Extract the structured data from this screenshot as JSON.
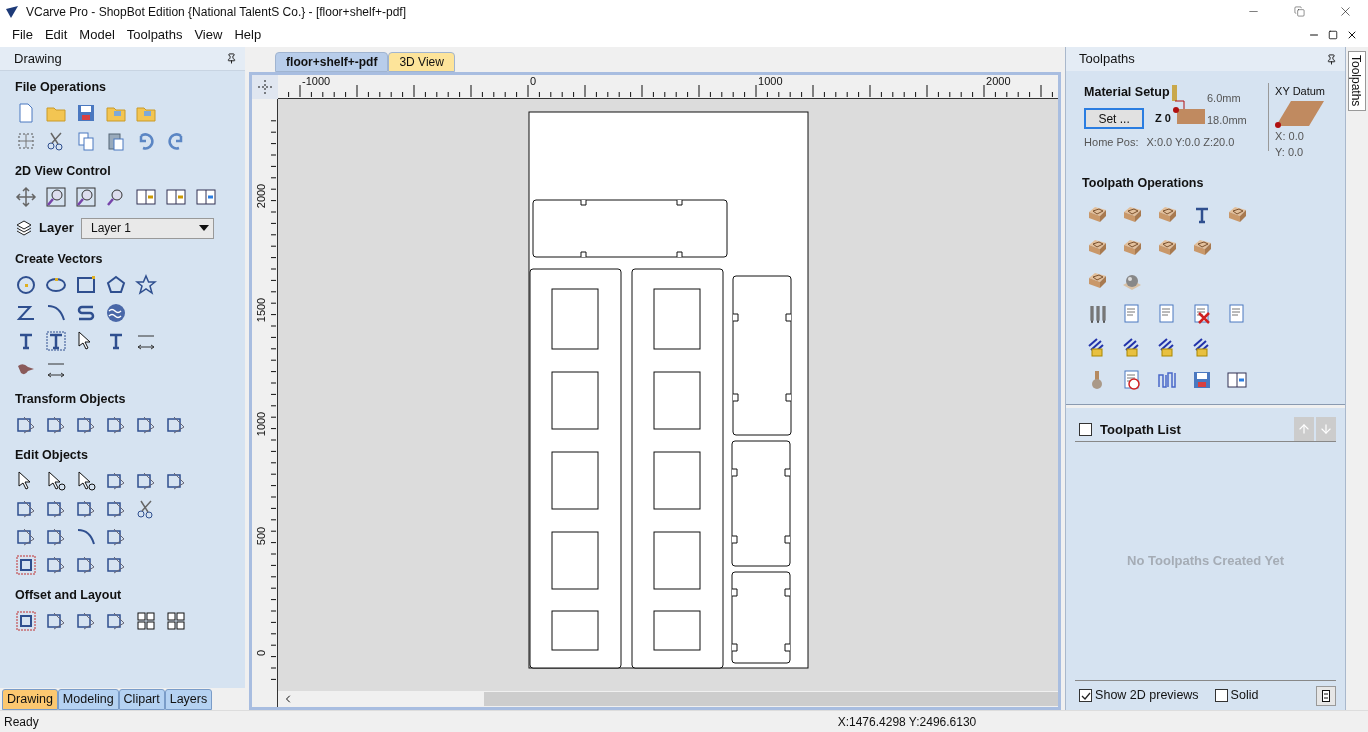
{
  "window": {
    "title": "VCarve Pro - ShopBot Edition {National TalentS Co.} - [floor+shelf+-pdf]"
  },
  "menu": [
    "File",
    "Edit",
    "Model",
    "Toolpaths",
    "View",
    "Help"
  ],
  "drawing_panel": {
    "title": "Drawing",
    "sections": [
      {
        "title": "File Operations"
      },
      {
        "title": "2D View Control",
        "layer": {
          "label": "Layer",
          "value": "Layer 1"
        }
      },
      {
        "title": "Create Vectors"
      },
      {
        "title": "Transform Objects"
      },
      {
        "title": "Edit Objects"
      },
      {
        "title": "Offset and Layout"
      }
    ],
    "tabs": [
      {
        "label": "Drawing",
        "selected": true
      },
      {
        "label": "Modeling",
        "selected": false
      },
      {
        "label": "Clipart",
        "selected": false
      },
      {
        "label": "Layers",
        "selected": false
      }
    ]
  },
  "document_tabs": [
    {
      "label": "floor+shelf+-pdf",
      "selected": true
    },
    {
      "label": "3D View",
      "selected": false
    }
  ],
  "rulers": {
    "horizontal": [
      "-1000",
      "0",
      "1000",
      "2000"
    ],
    "vertical": [
      "2000",
      "1500",
      "1000",
      "500",
      "0"
    ]
  },
  "toolpaths_panel": {
    "title": "Toolpaths",
    "material_setup": {
      "title": "Material Setup",
      "button": "Set ...",
      "z_label": "Z 0",
      "top_offset": "6.0mm",
      "thickness": "18.0mm",
      "home_label": "Home Pos:",
      "home_value": "X:0.0 Y:0.0 Z:20.0",
      "datum_title": "XY Datum",
      "datum_x": "X: 0.0",
      "datum_y": "Y: 0.0"
    },
    "operations_title": "Toolpath Operations",
    "list": {
      "title": "Toolpath List",
      "checked": false,
      "empty_text": "No Toolpaths Created Yet",
      "options": [
        {
          "label": "Show 2D previews",
          "checked": true
        },
        {
          "label": "Solid",
          "checked": false
        }
      ]
    }
  },
  "side_tab": "Toolpaths",
  "status_bar": {
    "text": "Ready",
    "coordinates": "X:1476.4298 Y:2496.6130"
  }
}
